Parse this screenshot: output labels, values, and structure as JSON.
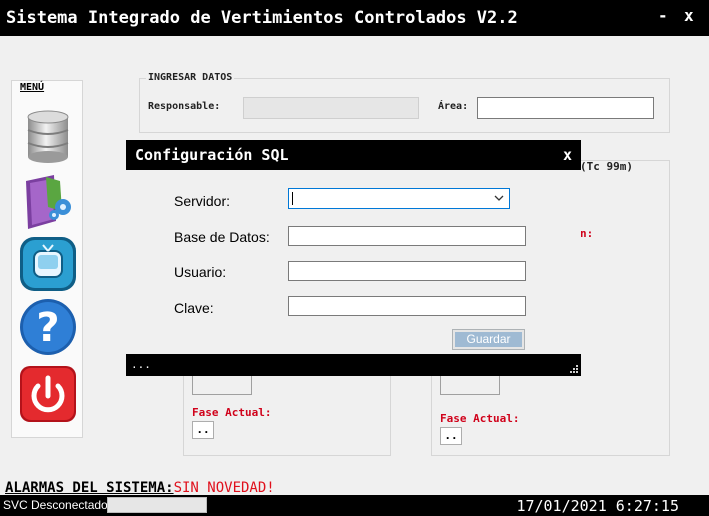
{
  "window": {
    "title": "Sistema Integrado de Vertimientos Controlados V2.2",
    "minimize_glyph": "-",
    "close_glyph": "x"
  },
  "sidebar": {
    "label": "MENÚ",
    "items": [
      {
        "name": "database-icon"
      },
      {
        "name": "folder-settings-icon"
      },
      {
        "name": "monitor-icon"
      },
      {
        "name": "help-icon"
      },
      {
        "name": "power-icon"
      }
    ]
  },
  "ingresar": {
    "legend": "INGRESAR DATOS",
    "responsable_label": "Responsable:",
    "responsable_value": "",
    "area_label": "Área:",
    "area_value": ""
  },
  "background_panels": {
    "right_header_fragment": "(Tc 99m)",
    "right_label_fragment": "n:",
    "left": {
      "fase_label": "Fase Actual:",
      "button_label": ".."
    },
    "right": {
      "fase_label": "Fase Actual:",
      "button_label": ".."
    }
  },
  "dialog": {
    "title": "Configuración SQL",
    "close_glyph": "x",
    "servidor_label": "Servidor:",
    "servidor_value": "",
    "base_label": "Base de Datos:",
    "base_value": "",
    "usuario_label": "Usuario:",
    "usuario_value": "",
    "clave_label": "Clave:",
    "clave_value": "",
    "save_label": "Guardar",
    "status_text": "..."
  },
  "alarms": {
    "label": "ALARMAS DEL SISTEMA:",
    "value": "SIN NOVEDAD!"
  },
  "statusbar": {
    "svc_text": "SVC Desconectado",
    "datetime": "17/01/2021 6:27:15"
  },
  "colors": {
    "titlebar": "#000000",
    "alarm_red": "#e0101c",
    "label_red": "#d0021b",
    "save_button": "#9fbad3"
  }
}
